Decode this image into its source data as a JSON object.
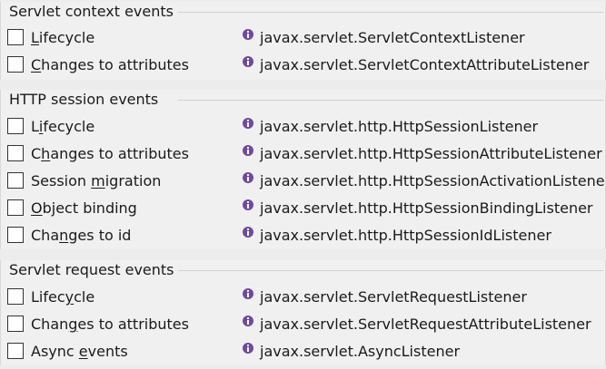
{
  "colors": {
    "background": "#f0f0f0",
    "text": "#1a1a1a",
    "info_icon": "#6c4ba0"
  },
  "groups": [
    {
      "title": "Servlet context events",
      "rows": [
        {
          "label": "Lifecycle",
          "mnemonic": "L",
          "checked": false,
          "icon": "info-icon",
          "listener": "javax.servlet.ServletContextListener"
        },
        {
          "label": "Changes to attributes",
          "mnemonic": "C",
          "checked": false,
          "icon": "info-icon",
          "listener": "javax.servlet.ServletContextAttributeListener"
        }
      ]
    },
    {
      "title": "HTTP session events",
      "rows": [
        {
          "label": "Lifecycle",
          "mnemonic": "i",
          "checked": false,
          "icon": "info-icon",
          "listener": "javax.servlet.http.HttpSessionListener"
        },
        {
          "label": "Changes to attributes",
          "mnemonic": "h",
          "checked": false,
          "icon": "info-icon",
          "listener": "javax.servlet.http.HttpSessionAttributeListener"
        },
        {
          "label": "Session migration",
          "mnemonic": "m",
          "checked": false,
          "icon": "info-icon",
          "listener": "javax.servlet.http.HttpSessionActivationListener"
        },
        {
          "label": "Object binding",
          "mnemonic": "O",
          "checked": false,
          "icon": "info-icon",
          "listener": "javax.servlet.http.HttpSessionBindingListener"
        },
        {
          "label": "Changes to id",
          "mnemonic": "n",
          "checked": false,
          "icon": "info-icon",
          "listener": "javax.servlet.http.HttpSessionIdListener"
        }
      ]
    },
    {
      "title": "Servlet request events",
      "rows": [
        {
          "label": "Lifecycle",
          "mnemonic": "y",
          "checked": false,
          "icon": "info-icon",
          "listener": "javax.servlet.ServletRequestListener"
        },
        {
          "label": "Changes to attributes",
          "mnemonic": "g",
          "checked": false,
          "icon": "info-icon",
          "listener": "javax.servlet.ServletRequestAttributeListener"
        },
        {
          "label": "Async events",
          "mnemonic": "e",
          "checked": false,
          "icon": "info-icon",
          "listener": "javax.servlet.AsyncListener"
        }
      ]
    }
  ]
}
